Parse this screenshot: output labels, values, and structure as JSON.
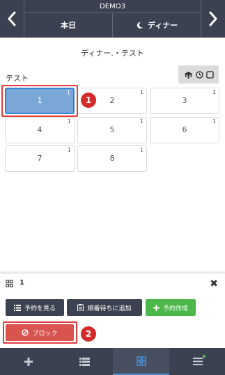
{
  "header": {
    "shop_name": "DEMO3",
    "date_label": "本日",
    "meal_label": "ディナー",
    "floor_title": "ディナー.・テスト"
  },
  "section": {
    "label": "テスト"
  },
  "tables": [
    {
      "number": "1",
      "capacity": "1",
      "selected": true
    },
    {
      "number": "2",
      "capacity": "1"
    },
    {
      "number": "3",
      "capacity": "1"
    },
    {
      "number": "4",
      "capacity": "1"
    },
    {
      "number": "5",
      "capacity": "1"
    },
    {
      "number": "6",
      "capacity": "1"
    },
    {
      "number": "7",
      "capacity": "1"
    },
    {
      "number": "8",
      "capacity": "1"
    }
  ],
  "annotations": {
    "step1": "1",
    "step2": "2"
  },
  "panel": {
    "title": "1",
    "buttons": {
      "view_reservations": "予約を見る",
      "add_waitlist": "順番待ちに追加",
      "create_reservation": "予約作成",
      "block": "ブロック"
    }
  },
  "colors": {
    "topbar": "#3b4150",
    "selected_tile": "#7ba7d6",
    "green_button": "#4cb84c",
    "red_button": "#d9534f",
    "annotation_red": "#d52a2a"
  },
  "icons": {
    "prev": "chevron-left-icon",
    "next": "chevron-right-icon",
    "meal": "moon-icon",
    "views": [
      "table-view-icon",
      "clock-icon",
      "square-icon"
    ],
    "panel": "grid-icon",
    "close": "close-icon",
    "nav": [
      "plus-icon",
      "list-icon",
      "grid-icon",
      "menu-icon"
    ]
  }
}
